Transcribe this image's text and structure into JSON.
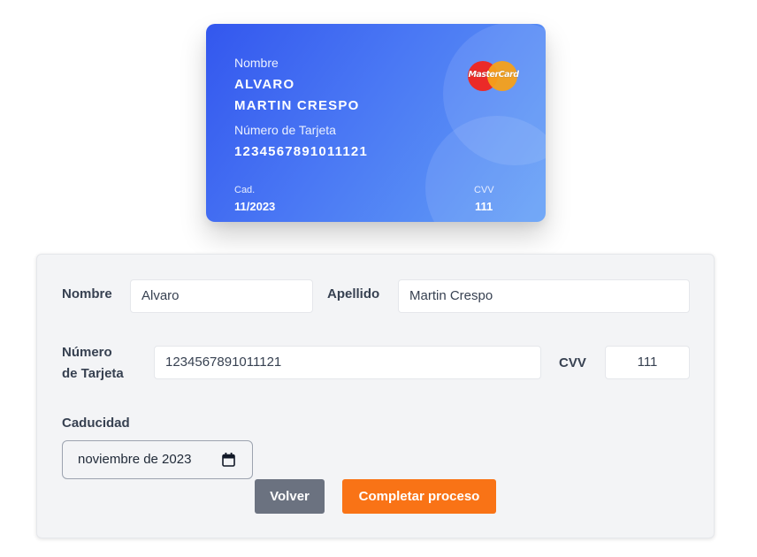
{
  "card": {
    "name_label": "Nombre",
    "first_name": "ALVARO",
    "last_name": "MARTIN CRESPO",
    "number_label": "Número de Tarjeta",
    "number": "1234567891011121",
    "expiry_label": "Cad.",
    "expiry": "11/2023",
    "cvv_label": "CVV",
    "cvv": "111",
    "brand_logo_text": "MasterCard",
    "gradient_colors": [
      "#3357ee",
      "#64a0f6"
    ]
  },
  "form": {
    "name_label": "Nombre",
    "name_value": "Alvaro",
    "surname_label": "Apellido",
    "surname_value": "Martin Crespo",
    "number_label_line1": "Número",
    "number_label_line2": "de Tarjeta",
    "number_value": "1234567891011121",
    "cvv_label": "CVV",
    "cvv_value": "111",
    "expiry_label": "Caducidad",
    "expiry_value": "noviembre de 2023",
    "calendar_icon": "calendar-icon"
  },
  "buttons": {
    "back_label": "Volver",
    "back_color": "#6b7280",
    "complete_label": "Completar proceso",
    "complete_color": "#f97316"
  }
}
